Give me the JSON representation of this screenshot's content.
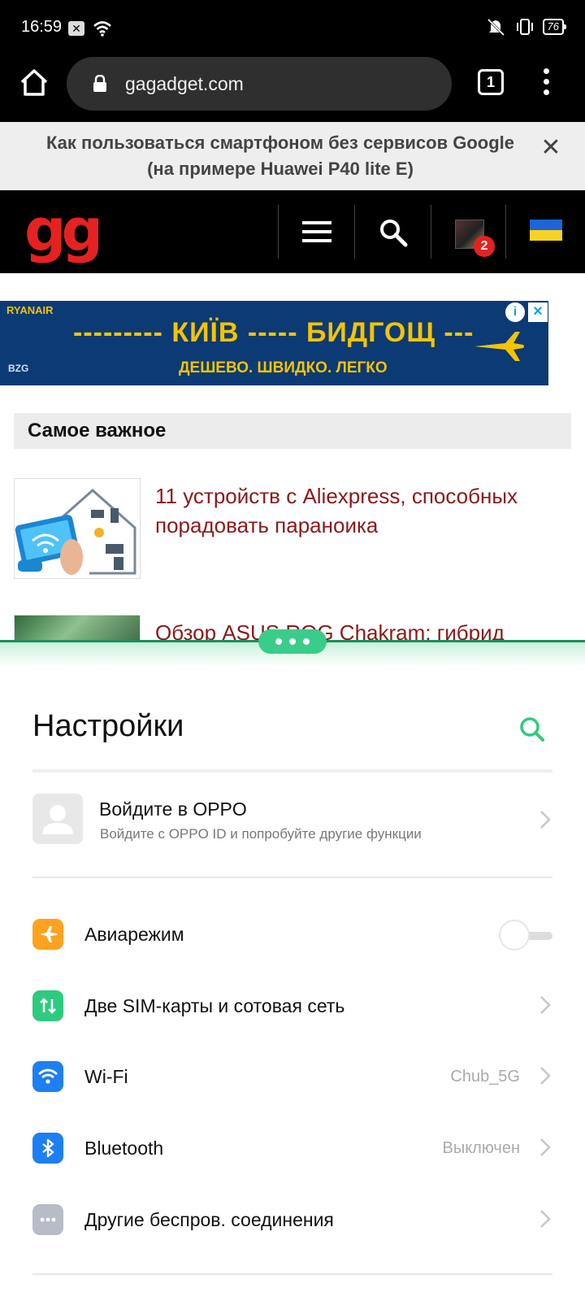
{
  "status_bar": {
    "time": "16:59",
    "battery": "76"
  },
  "browser": {
    "url": "gagadget.com",
    "tab_count": "1"
  },
  "banner": {
    "text": "Как пользоваться смартфоном без сервисов Google (на примере Huawei P40 lite E)",
    "close": "✕"
  },
  "site": {
    "logo": "gg",
    "notification_count": "2"
  },
  "ad": {
    "brand": "RYANAIR",
    "headline": "--------- КИЇВ ----- БИДГОЩ ---",
    "subline": "ДЕШЕВО. ШВИДКО. ЛЕГКО",
    "logo_text": "BZG"
  },
  "section": {
    "title": "Самое важное",
    "articles": [
      {
        "title": "11 устройств с Aliexpress, способных порадовать параноика"
      },
      {
        "title": "Обзор ASUS ROG Chakram: гибрид"
      }
    ]
  },
  "settings": {
    "title": "Настройки",
    "account": {
      "title": "Войдите в OPPO",
      "subtitle": "Войдите с OPPO ID и попробуйте другие функции"
    },
    "items": [
      {
        "label": "Авиарежим",
        "value": "",
        "icon": "airplane-icon",
        "color": "#ffa21f",
        "toggle": false
      },
      {
        "label": "Две SIM-карты и сотовая сеть",
        "value": "",
        "icon": "sim-icon",
        "color": "#2ecb7e"
      },
      {
        "label": "Wi-Fi",
        "value": "Chub_5G",
        "icon": "wifi-icon",
        "color": "#1e7ff2"
      },
      {
        "label": "Bluetooth",
        "value": "Выключен",
        "icon": "bluetooth-icon",
        "color": "#1e7ff2"
      },
      {
        "label": "Другие беспров. соединения",
        "value": "",
        "icon": "more-icon",
        "color": "#b8bcc6"
      }
    ]
  },
  "colors": {
    "accent": "#2ecb7e",
    "site_red": "#e52222",
    "link": "#8b1a1a"
  }
}
